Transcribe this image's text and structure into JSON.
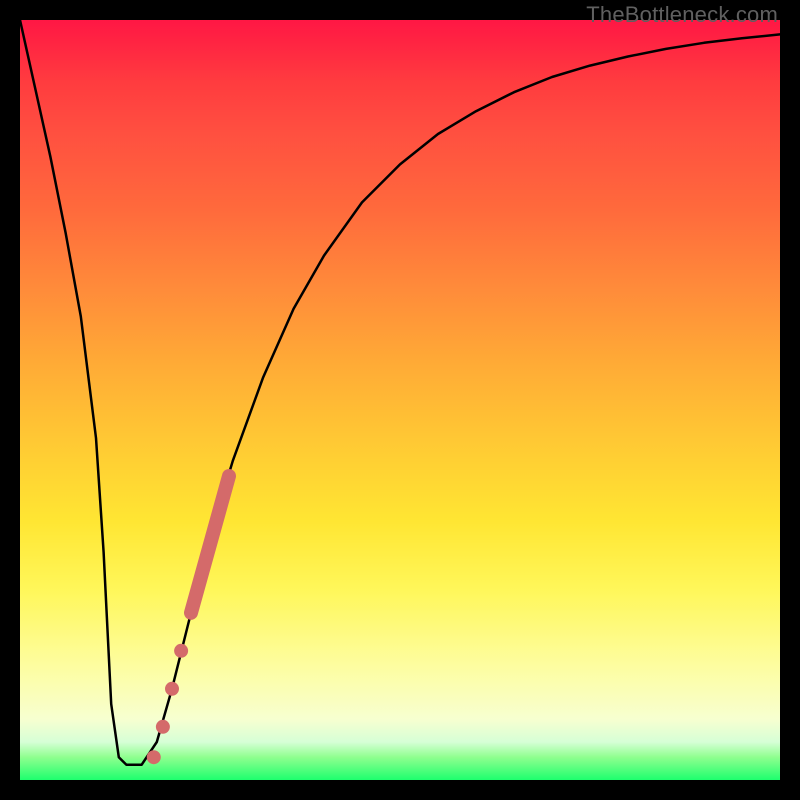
{
  "watermark": "TheBottleneck.com",
  "chart_data": {
    "type": "line",
    "title": "",
    "xlabel": "",
    "ylabel": "",
    "xlim": [
      0,
      100
    ],
    "ylim": [
      0,
      100
    ],
    "grid": false,
    "legend": false,
    "series": [
      {
        "name": "bottleneck-curve",
        "color": "#000000",
        "x": [
          0,
          2,
          4,
          6,
          8,
          10,
          11,
          12,
          13,
          14,
          16,
          18,
          20,
          22,
          25,
          28,
          32,
          36,
          40,
          45,
          50,
          55,
          60,
          65,
          70,
          75,
          80,
          85,
          90,
          95,
          100
        ],
        "y": [
          100,
          91,
          82,
          72,
          61,
          45,
          30,
          10,
          3,
          2,
          2,
          5,
          12,
          20,
          32,
          42,
          53,
          62,
          69,
          76,
          81,
          85,
          88,
          90.5,
          92.5,
          94,
          95.2,
          96.2,
          97,
          97.6,
          98.1
        ]
      }
    ],
    "markers": [
      {
        "name": "segment-pink",
        "type": "segment",
        "color": "#d46a6a",
        "width": 14,
        "x": [
          22.5,
          27.5
        ],
        "y": [
          22,
          40
        ]
      },
      {
        "name": "dot-1",
        "type": "dot",
        "color": "#d46a6a",
        "r": 7,
        "x": 21.2,
        "y": 17
      },
      {
        "name": "dot-2",
        "type": "dot",
        "color": "#d46a6a",
        "r": 7,
        "x": 20.0,
        "y": 12
      },
      {
        "name": "dot-3",
        "type": "dot",
        "color": "#d46a6a",
        "r": 7,
        "x": 18.8,
        "y": 7
      },
      {
        "name": "dot-4",
        "type": "dot",
        "color": "#d46a6a",
        "r": 7,
        "x": 17.6,
        "y": 3
      }
    ]
  }
}
